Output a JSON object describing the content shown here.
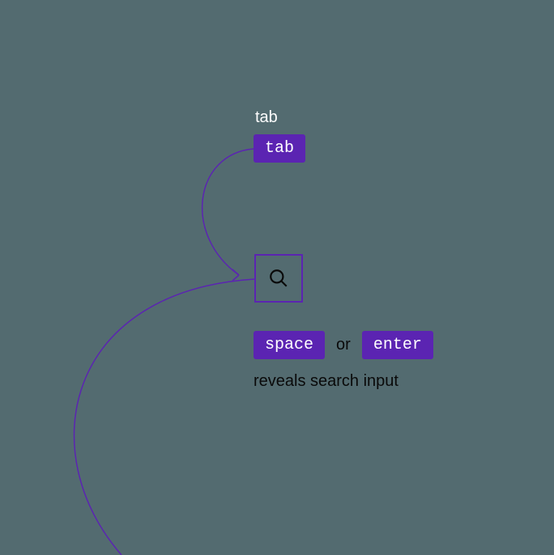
{
  "diagram": {
    "top_label": "tab",
    "tab_key": "tab",
    "space_key": "space",
    "or_text": "or",
    "enter_key": "enter",
    "reveals_text": "reveals search input"
  }
}
